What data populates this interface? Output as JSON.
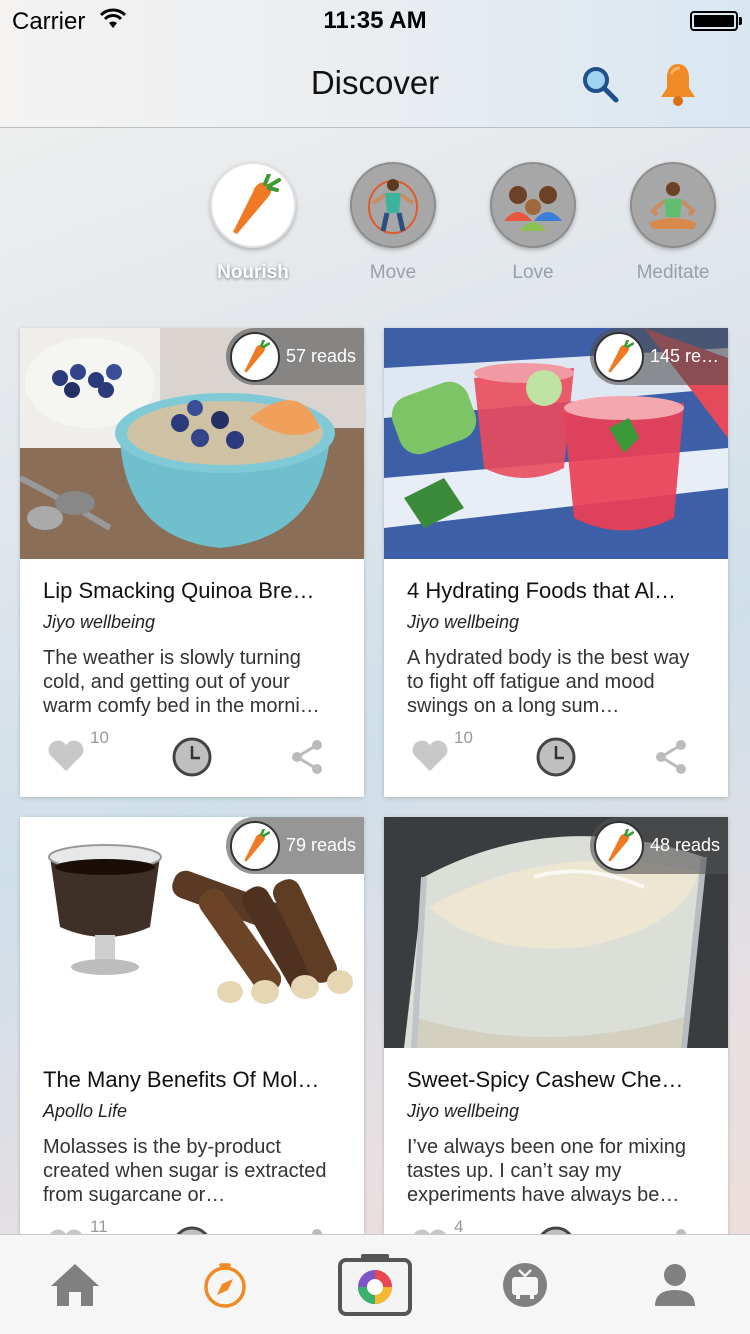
{
  "status_bar": {
    "carrier": "Carrier",
    "time": "11:35 AM"
  },
  "header": {
    "title": "Discover",
    "icons": [
      "search-icon",
      "bell-icon"
    ]
  },
  "categories": [
    {
      "label": "Nourish",
      "icon": "carrot-icon",
      "active": true
    },
    {
      "label": "Move",
      "icon": "jump-rope-icon",
      "active": false
    },
    {
      "label": "Love",
      "icon": "family-icon",
      "active": false
    },
    {
      "label": "Meditate",
      "icon": "meditation-icon",
      "active": false
    }
  ],
  "cards": [
    {
      "reads": "57 reads",
      "title": "Lip Smacking Quinoa Bre…",
      "author": "Jiyo wellbeing",
      "description": "The weather is slowly turning cold, and getting out of your warm comfy bed in the morni…",
      "likes": "10"
    },
    {
      "reads": "145 re…",
      "title": "4 Hydrating Foods that Al…",
      "author": "Jiyo wellbeing",
      "description": "A hydrated body is the best way to fight off fatigue and mood swings on a long sum…",
      "likes": "10"
    },
    {
      "reads": "79 reads",
      "title": "The Many Benefits Of Mol…",
      "author": "Apollo Life",
      "description": "Molasses is the by-product created when sugar is extracted from sugarcane or…",
      "likes": "11"
    },
    {
      "reads": "48 reads",
      "title": "Sweet-Spicy Cashew Che…",
      "author": "Jiyo wellbeing",
      "description": "I’ve always been one for mixing tastes up. I can’t say my experiments have always be…",
      "likes": "4"
    }
  ],
  "tab_bar": {
    "tabs": [
      "home-icon",
      "compass-icon",
      "camera-icon",
      "tv-icon",
      "profile-icon"
    ],
    "active": "compass-icon"
  },
  "colors": {
    "accent": "#f08a24",
    "inactive": "#8e8e93"
  }
}
